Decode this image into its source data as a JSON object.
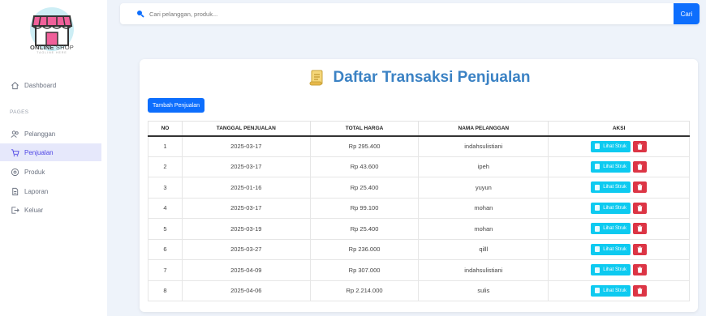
{
  "brand": {
    "name_bold": "ONLINE",
    "name_light": "SHOP",
    "tagline": "TAGLINE HERE"
  },
  "sidebar": {
    "items": [
      {
        "label": "Dashboard",
        "icon": "home-icon"
      },
      {
        "label": "Pelanggan",
        "icon": "users-icon"
      },
      {
        "label": "Penjualan",
        "icon": "cart-icon",
        "active": true
      },
      {
        "label": "Produk",
        "icon": "box-icon"
      },
      {
        "label": "Laporan",
        "icon": "document-icon"
      },
      {
        "label": "Keluar",
        "icon": "logout-icon"
      }
    ],
    "section_label": "PAGES"
  },
  "search": {
    "placeholder": "Cari pelanggan, produk...",
    "button_label": "Cari"
  },
  "main": {
    "title": "Daftar Transaksi Penjualan",
    "add_button": "Tambah Penjualan",
    "columns": [
      "NO",
      "TANGGAL PENJUALAN",
      "TOTAL HARGA",
      "NAMA PELANGGAN",
      "AKSI"
    ],
    "view_label": "Lihat Struk",
    "rows": [
      {
        "no": "1",
        "date": "2025-03-17",
        "total": "Rp 295.400",
        "customer": "indahsulistiani"
      },
      {
        "no": "2",
        "date": "2025-03-17",
        "total": "Rp 43.600",
        "customer": "ipeh"
      },
      {
        "no": "3",
        "date": "2025-01-16",
        "total": "Rp 25.400",
        "customer": "yuyun"
      },
      {
        "no": "4",
        "date": "2025-03-17",
        "total": "Rp 99.100",
        "customer": "mohan"
      },
      {
        "no": "5",
        "date": "2025-03-19",
        "total": "Rp 25.400",
        "customer": "mohan"
      },
      {
        "no": "6",
        "date": "2025-03-27",
        "total": "Rp 236.000",
        "customer": "qilll"
      },
      {
        "no": "7",
        "date": "2025-04-09",
        "total": "Rp 307.000",
        "customer": "indahsulistiani"
      },
      {
        "no": "8",
        "date": "2025-04-06",
        "total": "Rp 2.214.000",
        "customer": "sulis"
      }
    ]
  },
  "colors": {
    "primary": "#0d6efd",
    "info": "#0dcaf0",
    "danger": "#dc3545",
    "title": "#3b82c4",
    "active_bg": "#e6e8fb"
  }
}
